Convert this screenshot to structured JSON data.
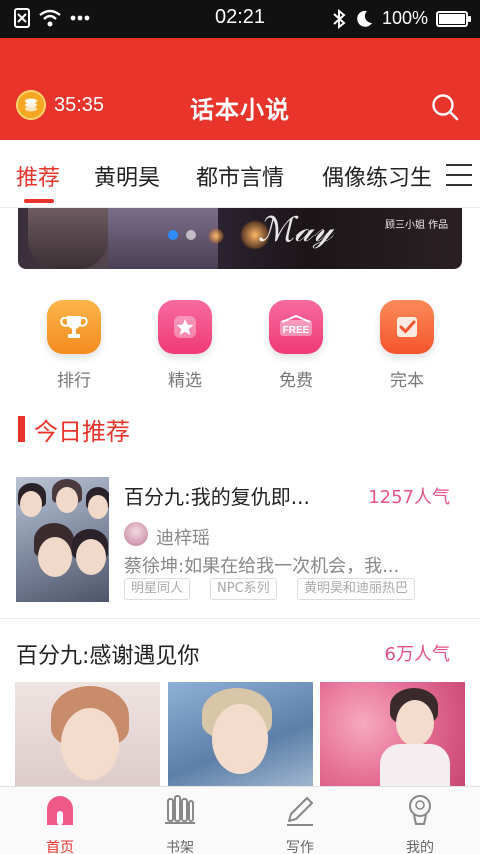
{
  "status_bar": {
    "time": "02:21",
    "battery": "100%",
    "battery_level": 1.0
  },
  "header": {
    "timer": "35:35",
    "title": "话本小说",
    "search_icon": "search-icon"
  },
  "tabs": [
    {
      "label": "推荐",
      "active": true
    },
    {
      "label": "黄明昊",
      "active": false
    },
    {
      "label": "都市言情",
      "active": false
    },
    {
      "label": "偶像练习生",
      "active": false
    }
  ],
  "banner": {
    "author_text": "顾三小姐 作品",
    "slide_count": 2,
    "active_slide": 0
  },
  "categories": [
    {
      "label": "排行",
      "icon": "trophy-icon",
      "color": "#f79a2c"
    },
    {
      "label": "精选",
      "icon": "star-icon",
      "color": "#f24e86"
    },
    {
      "label": "免费",
      "icon": "free-icon",
      "color": "#f24e86"
    },
    {
      "label": "完本",
      "icon": "check-book-icon",
      "color": "#f7663a"
    }
  ],
  "today": {
    "section_title": "今日推荐",
    "book": {
      "title": "百分九:我的复仇即...",
      "popularity": "1257人气",
      "author": "迪梓瑶",
      "description": "蔡徐坤:如果在给我一次机会，我...",
      "tags": [
        "明星同人",
        "NPC系列",
        "黄明昊和迪丽热巴"
      ]
    }
  },
  "section2": {
    "title": "百分九:感谢遇见你",
    "popularity": "6万人气"
  },
  "bottom_nav": [
    {
      "label": "首页",
      "icon": "home-icon",
      "active": true
    },
    {
      "label": "书架",
      "icon": "bookshelf-icon",
      "active": false
    },
    {
      "label": "写作",
      "icon": "pen-icon",
      "active": false
    },
    {
      "label": "我的",
      "icon": "profile-icon",
      "active": false
    }
  ],
  "colors": {
    "brand_red": "#e9342c",
    "popularity_pink": "#e8528a"
  }
}
